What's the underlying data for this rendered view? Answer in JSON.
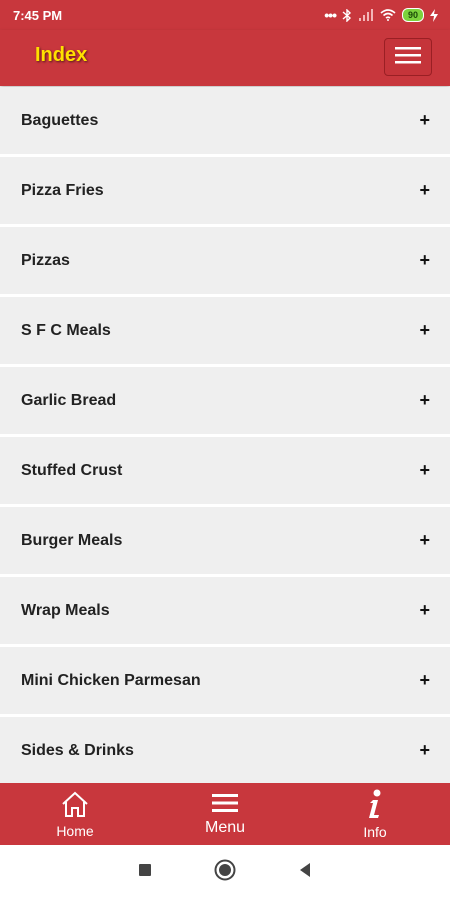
{
  "status_bar": {
    "time": "7:45 PM",
    "battery": "90"
  },
  "app_bar": {
    "title": "Index"
  },
  "categories": [
    {
      "label": "Baguettes"
    },
    {
      "label": "Pizza Fries"
    },
    {
      "label": "Pizzas"
    },
    {
      "label": "S F C Meals"
    },
    {
      "label": "Garlic Bread"
    },
    {
      "label": "Stuffed Crust"
    },
    {
      "label": "Burger Meals"
    },
    {
      "label": "Wrap Meals"
    },
    {
      "label": "Mini Chicken Parmesan"
    },
    {
      "label": "Sides & Drinks"
    }
  ],
  "expand_symbol": "+",
  "bottom_nav": {
    "home_label": "Home",
    "menu_label": "Menu",
    "info_label": "Info"
  },
  "colors": {
    "primary": "#c8373d",
    "title": "#ffe000",
    "list_bg": "#efefef"
  },
  "icons": [
    "dots-icon",
    "bluetooth-icon",
    "signal-icon",
    "wifi-icon",
    "battery-icon",
    "charging-icon",
    "hamburger-icon",
    "home-icon",
    "menu-lines-icon",
    "info-icon",
    "recent-apps-icon",
    "home-circle-icon",
    "back-icon"
  ]
}
